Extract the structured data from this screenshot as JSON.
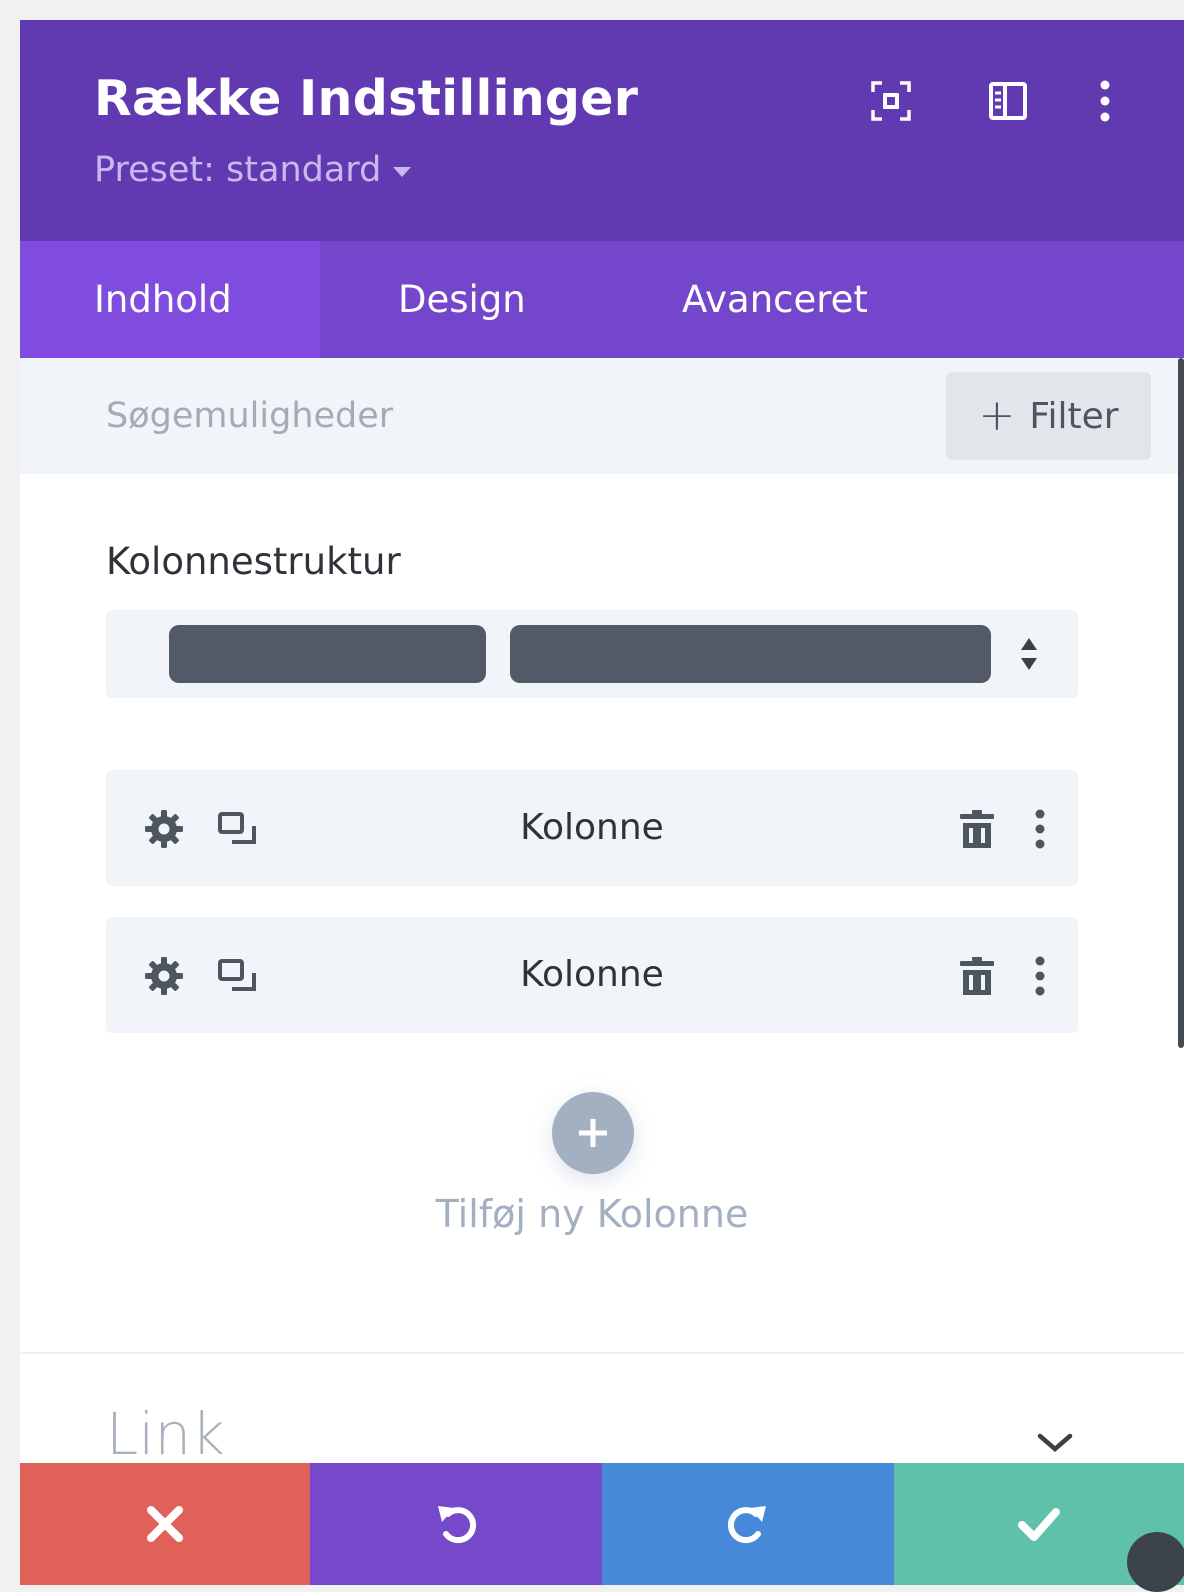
{
  "header": {
    "title": "Række Indstillinger",
    "preset_label": "Preset: standard",
    "icons": [
      "fullscreen-icon",
      "sidebar-layout-icon",
      "more-vertical-icon"
    ],
    "background": "#6139b0"
  },
  "tabs": [
    {
      "label": "Indhold",
      "active": true
    },
    {
      "label": "Design",
      "active": false
    },
    {
      "label": "Avanceret",
      "active": false
    }
  ],
  "search": {
    "placeholder": "Søgemuligheder",
    "filter_label": "Filter"
  },
  "column_structure": {
    "label": "Kolonnestruktur",
    "columns": 2
  },
  "columns": [
    {
      "label": "Kolonne"
    },
    {
      "label": "Kolonne"
    }
  ],
  "add_column": {
    "label": "Tilføj ny Kolonne"
  },
  "link_section": {
    "title": "Link"
  },
  "bottom_bar": {
    "buttons": [
      {
        "name": "cancel",
        "icon": "close-icon",
        "color": "#e0605a"
      },
      {
        "name": "undo",
        "icon": "undo-icon",
        "color": "#7549c9"
      },
      {
        "name": "redo",
        "icon": "redo-icon",
        "color": "#4689d8"
      },
      {
        "name": "save",
        "icon": "check-icon",
        "color": "#5fc1aa"
      }
    ]
  }
}
